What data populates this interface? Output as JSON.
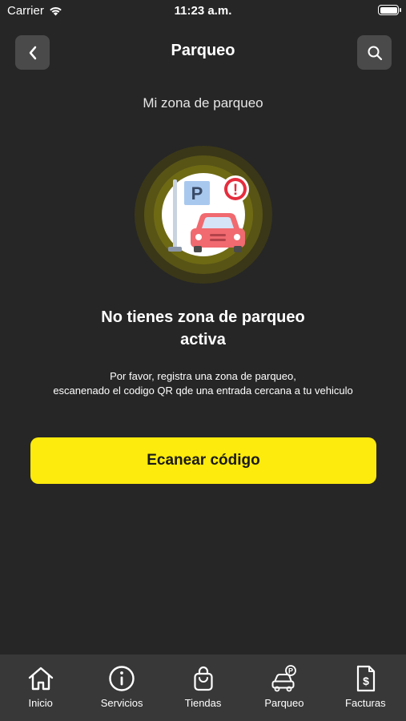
{
  "status_bar": {
    "carrier": "Carrier",
    "time": "11:23 a.m."
  },
  "header": {
    "title": "Parqueo",
    "back_icon": "chevron-left-icon",
    "search_icon": "search-icon"
  },
  "main": {
    "subtitle": "Mi zona de parqueo",
    "illustration": {
      "sign_letter": "P",
      "alert_glyph": "!"
    },
    "empty_title_line1": "No tienes zona de parqueo",
    "empty_title_line2": "activa",
    "desc_line1": "Por favor, registra una zona de parqueo,",
    "desc_line2": "escanenado el codigo QR qde una entrada cercana a tu vehiculo",
    "scan_button_label": "Ecanear código"
  },
  "tab_bar": {
    "items": [
      {
        "label": "Inicio",
        "icon": "home-icon"
      },
      {
        "label": "Servicios",
        "icon": "info-icon"
      },
      {
        "label": "Tiendas",
        "icon": "shopping-bag-icon"
      },
      {
        "label": "Parqueo",
        "icon": "parking-car-icon"
      },
      {
        "label": "Facturas",
        "icon": "invoice-icon"
      }
    ]
  },
  "colors": {
    "background": "#262626",
    "accent": "#fdeb0d",
    "tab_bar": "#383838",
    "icon_button": "#4a4a4a"
  }
}
